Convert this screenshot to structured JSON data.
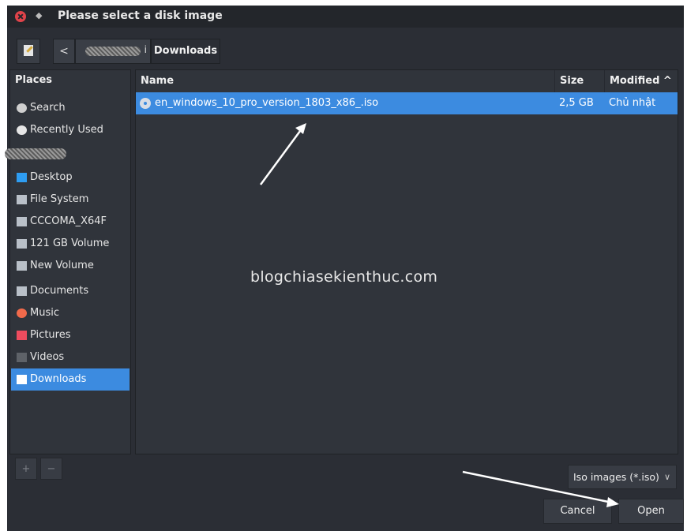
{
  "window": {
    "title": "Please select a disk image"
  },
  "breadcrumb": {
    "back_label": "<",
    "home_tail": "i",
    "current": "Downloads"
  },
  "sidebar": {
    "header": "Places",
    "items": [
      {
        "label": "Search",
        "icon": "search-icon",
        "color": "#cfcfcf"
      },
      {
        "label": "Recently Used",
        "icon": "clock-icon",
        "color": "#e6e6e6"
      },
      {
        "label": "",
        "icon": "home-icon",
        "color": "#e0a06a"
      },
      {
        "label": "Desktop",
        "icon": "desktop-folder-icon",
        "color": "#2e9df2"
      },
      {
        "label": "File System",
        "icon": "drive-icon",
        "color": "#b9c0c8"
      },
      {
        "label": "CCCOMA_X64F",
        "icon": "disc-drive-icon",
        "color": "#b9c0c8"
      },
      {
        "label": "121 GB Volume",
        "icon": "drive-icon",
        "color": "#b9c0c8"
      },
      {
        "label": "New Volume",
        "icon": "drive-icon",
        "color": "#b9c0c8"
      },
      {
        "label": "Documents",
        "icon": "documents-folder-icon",
        "color": "#b9c0c8"
      },
      {
        "label": "Music",
        "icon": "music-icon",
        "color": "#f16a4b"
      },
      {
        "label": "Pictures",
        "icon": "pictures-icon",
        "color": "#ee4c5e"
      },
      {
        "label": "Videos",
        "icon": "videos-icon",
        "color": "#5e6268"
      },
      {
        "label": "Downloads",
        "icon": "download-icon",
        "color": "#ffffff"
      }
    ],
    "active_index": 12,
    "add_label": "+",
    "remove_label": "−"
  },
  "filelist": {
    "columns": {
      "name": "Name",
      "size": "Size",
      "modified": "Modified ^"
    },
    "files": [
      {
        "name": "en_windows_10_pro_version_1803_x86_.iso",
        "size": "2,5 GB",
        "modified": "Chủ nhật"
      }
    ]
  },
  "watermark": "blogchiasekienthuc.com",
  "filter": {
    "selected": "Iso images (*.iso)"
  },
  "buttons": {
    "cancel": "Cancel",
    "open": "Open"
  },
  "colors": {
    "accent": "#3c8be0",
    "background": "#2b2e35",
    "close": "#e0434a"
  }
}
